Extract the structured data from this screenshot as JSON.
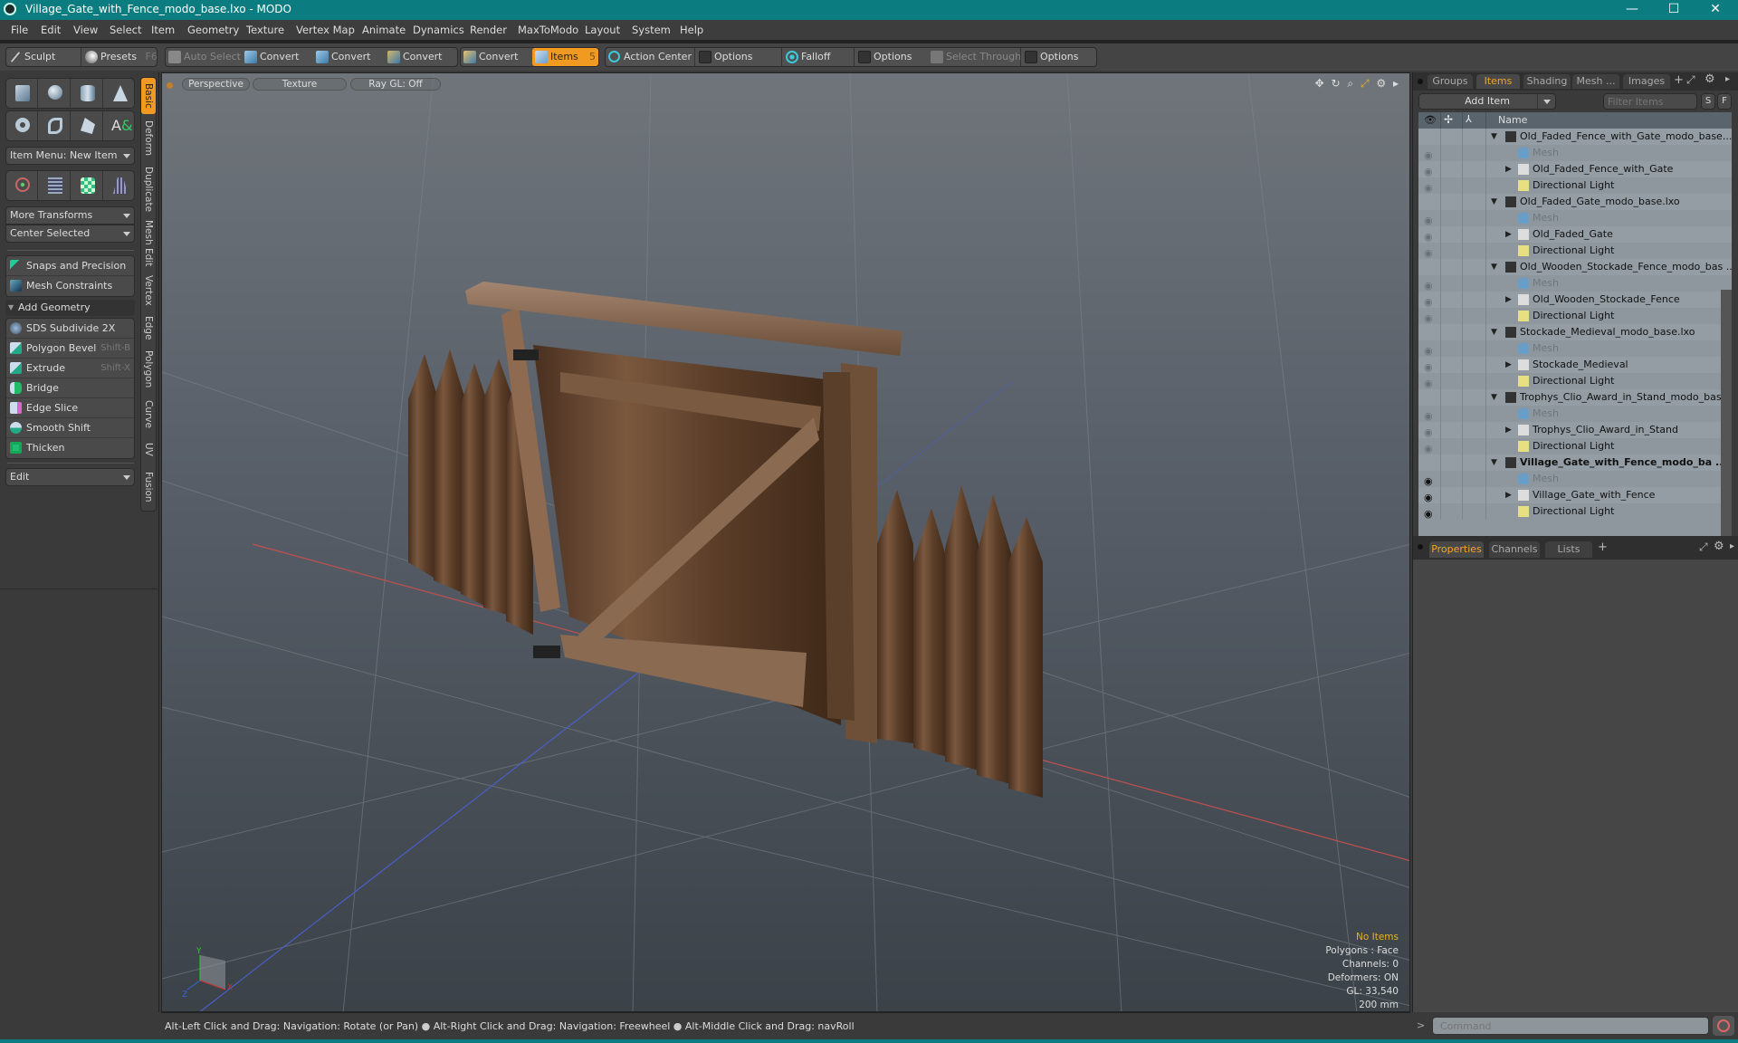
{
  "window": {
    "title": "Village_Gate_with_Fence_modo_base.lxo - MODO",
    "controls": {
      "minimize": "—",
      "maximize": "☐",
      "close": "✕"
    }
  },
  "menubar": [
    "File",
    "Edit",
    "View",
    "Select",
    "Item",
    "Geometry",
    "Texture",
    "Vertex Map",
    "Animate",
    "Dynamics",
    "Render",
    "MaxToModo",
    "Layout",
    "System",
    "Help"
  ],
  "toolbar": {
    "sculpt": "Sculpt",
    "presets": "Presets",
    "presets_shortcut": "F6",
    "auto_select": "Auto Select",
    "convert_vertices": "Convert",
    "convert_edges": "Convert",
    "convert_polygons": "Convert",
    "convert_materials": "Convert",
    "items": "Items",
    "items_count": "5",
    "action_center": "Action Center",
    "options1": "Options",
    "falloff": "Falloff",
    "options2": "Options",
    "select_through": "Select Through",
    "options3": "Options"
  },
  "leftpanel": {
    "item_menu": "Item Menu: New Item",
    "more_transforms": "More Transforms",
    "center_selected": "Center Selected",
    "snaps": "Snaps and Precision",
    "constraints": "Mesh Constraints",
    "add_geometry": "Add Geometry",
    "geometry_tools": [
      {
        "label": "SDS Subdivide 2X",
        "shortcut": ""
      },
      {
        "label": "Polygon Bevel",
        "shortcut": "Shift-B"
      },
      {
        "label": "Extrude",
        "shortcut": "Shift-X"
      },
      {
        "label": "Bridge",
        "shortcut": ""
      },
      {
        "label": "Edge Slice",
        "shortcut": ""
      },
      {
        "label": "Smooth Shift",
        "shortcut": ""
      },
      {
        "label": "Thicken",
        "shortcut": ""
      }
    ],
    "edit_dropdown": "Edit",
    "vertical_tabs": [
      "Basic",
      "Deform",
      "Duplicate",
      "Mesh Edit",
      "Vertex",
      "Edge",
      "Polygon",
      "Curve",
      "UV",
      "Fusion"
    ],
    "active_tab": "Basic"
  },
  "viewport": {
    "view_mode": "Perspective",
    "shading": "Texture",
    "raygl": "Ray GL: Off",
    "info": {
      "selection": "No Items",
      "polygons": "Polygons : Face",
      "channels": "Channels: 0",
      "deformers": "Deformers: ON",
      "gl": "GL: 33,540",
      "scale": "200 mm"
    },
    "axes": {
      "x": "X",
      "y": "Y",
      "z": "Z"
    }
  },
  "rightpanel": {
    "tabs": [
      "Groups",
      "Items",
      "Shading",
      "Mesh ...",
      "Images"
    ],
    "active_tab": "Items",
    "add_item": "Add Item",
    "filter_placeholder": "Filter Items",
    "s_btn": "S",
    "f_btn": "F",
    "name_header": "Name",
    "tree": [
      {
        "type": "scene",
        "label": "Old_Faded_Fence_with_Gate_modo_base....",
        "bold": false,
        "visible": false
      },
      {
        "type": "mesh",
        "label": "Mesh",
        "visible": true
      },
      {
        "type": "group",
        "label": "Old_Faded_Fence_with_Gate",
        "visible": true
      },
      {
        "type": "light",
        "label": "Directional Light",
        "visible": true
      },
      {
        "type": "scene",
        "label": "Old_Faded_Gate_modo_base.lxo",
        "bold": false,
        "visible": false
      },
      {
        "type": "mesh",
        "label": "Mesh",
        "visible": true
      },
      {
        "type": "group",
        "label": "Old_Faded_Gate",
        "visible": true
      },
      {
        "type": "light",
        "label": "Directional Light",
        "visible": true
      },
      {
        "type": "scene",
        "label": "Old_Wooden_Stockade_Fence_modo_bas ...",
        "bold": false,
        "visible": false
      },
      {
        "type": "mesh",
        "label": "Mesh",
        "visible": true
      },
      {
        "type": "group",
        "label": "Old_Wooden_Stockade_Fence",
        "visible": true
      },
      {
        "type": "light",
        "label": "Directional Light",
        "visible": true
      },
      {
        "type": "scene",
        "label": "Stockade_Medieval_modo_base.lxo",
        "bold": false,
        "visible": false
      },
      {
        "type": "mesh",
        "label": "Mesh",
        "visible": true
      },
      {
        "type": "group",
        "label": "Stockade_Medieval",
        "visible": true
      },
      {
        "type": "light",
        "label": "Directional Light",
        "visible": true
      },
      {
        "type": "scene",
        "label": "Trophys_Clio_Award_in_Stand_modo_base...",
        "bold": false,
        "visible": false
      },
      {
        "type": "mesh",
        "label": "Mesh",
        "visible": true
      },
      {
        "type": "group",
        "label": "Trophys_Clio_Award_in_Stand",
        "visible": true
      },
      {
        "type": "light",
        "label": "Directional Light",
        "visible": true
      },
      {
        "type": "scene",
        "label": "Village_Gate_with_Fence_modo_ba ...",
        "bold": true,
        "visible": false
      },
      {
        "type": "mesh",
        "label": "Mesh",
        "visible": true,
        "active": true
      },
      {
        "type": "group",
        "label": "Village_Gate_with_Fence",
        "visible": true,
        "active": true
      },
      {
        "type": "light",
        "label": "Directional Light",
        "visible": true,
        "active": true
      }
    ],
    "bottom_tabs": [
      "Properties",
      "Channels",
      "Lists"
    ],
    "bottom_active": "Properties",
    "command_placeholder": "Command"
  },
  "statusbar": {
    "hint1": "Alt-Left Click and Drag: Navigation: Rotate (or Pan)",
    "hint2": "Alt-Right Click and Drag: Navigation: Freewheel",
    "hint3": "Alt-Middle Click and Drag: navRoll"
  },
  "colors": {
    "accent": "#f09a21",
    "titlebar": "#0b7d80"
  }
}
